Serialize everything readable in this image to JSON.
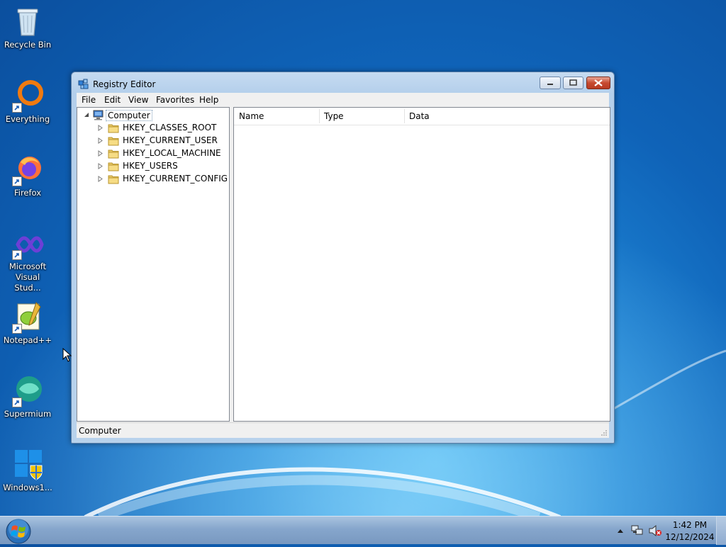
{
  "desktop": {
    "icons": [
      {
        "label": "Recycle Bin"
      },
      {
        "label": "Everything"
      },
      {
        "label": "Firefox"
      },
      {
        "label": "Microsoft Visual Stud..."
      },
      {
        "label": "Notepad++"
      },
      {
        "label": "Supermium"
      },
      {
        "label": "Windows1..."
      }
    ]
  },
  "window": {
    "title": "Registry Editor",
    "menu": [
      "File",
      "Edit",
      "View",
      "Favorites",
      "Help"
    ],
    "tree": {
      "root": "Computer",
      "keys": [
        "HKEY_CLASSES_ROOT",
        "HKEY_CURRENT_USER",
        "HKEY_LOCAL_MACHINE",
        "HKEY_USERS",
        "HKEY_CURRENT_CONFIG"
      ]
    },
    "columns": [
      "Name",
      "Type",
      "Data"
    ],
    "status": "Computer"
  },
  "taskbar": {
    "time": "1:42 PM",
    "date": "12/12/2024"
  },
  "colors": {
    "desktop": "#1e86d6",
    "close_button": "#c74a30",
    "taskbar": "#86a6cc"
  }
}
